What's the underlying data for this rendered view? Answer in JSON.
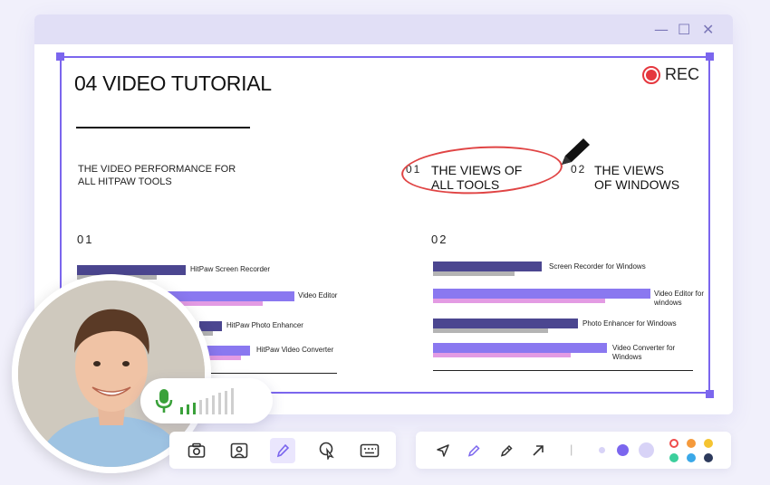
{
  "window": {
    "controls": {
      "minimize": "—",
      "maximize": "☐",
      "close": "✕"
    }
  },
  "slide": {
    "title": "04 VIDEO TUTORIAL",
    "subtitle": "THE VIDEO PERFORMANCE FOR ALL HITPAW TOOLS",
    "view1": {
      "num": "01",
      "label": "THE VIEWS OF ALL TOOLS"
    },
    "view2": {
      "num": "02",
      "label": "THE VIEWS OF WINDOWS"
    },
    "col1_num": "01",
    "col2_num": "02",
    "left_bars": [
      {
        "label": "HitPaw Screen Recorder"
      },
      {
        "label": "Video Editor"
      },
      {
        "label": "HitPaw Photo Enhancer"
      },
      {
        "label": "HitPaw Video Converter"
      }
    ],
    "right_bars": [
      {
        "label": "Screen Recorder for Windows"
      },
      {
        "label": "Video Editor for windows"
      },
      {
        "label": "Photo Enhancer for Windows"
      },
      {
        "label": "Video Converter for Windows"
      }
    ]
  },
  "recording": {
    "label": "REC",
    "color": "#e5373e"
  },
  "mic": {
    "active_bars": 3,
    "total_bars": 9,
    "active_color": "#3aa13a",
    "inactive_color": "#cfcfcf"
  },
  "toolbar_left": {
    "icons": [
      "camera-icon",
      "webcam-icon",
      "pen-icon",
      "cursor-select-icon",
      "keyboard-icon"
    ],
    "active": "pen-icon"
  },
  "toolbar_right": {
    "icons": [
      "pointer-icon",
      "pen-icon",
      "highlighter-icon",
      "arrow-icon"
    ],
    "separator": "|",
    "sizes": [
      "small",
      "medium",
      "large"
    ],
    "colors": [
      "#ef4b4b",
      "#f59a3c",
      "#f5c431",
      "#3ccf9c",
      "#3aa8e8",
      "#2d3a5c"
    ]
  },
  "accent_color": "#7b66ee"
}
